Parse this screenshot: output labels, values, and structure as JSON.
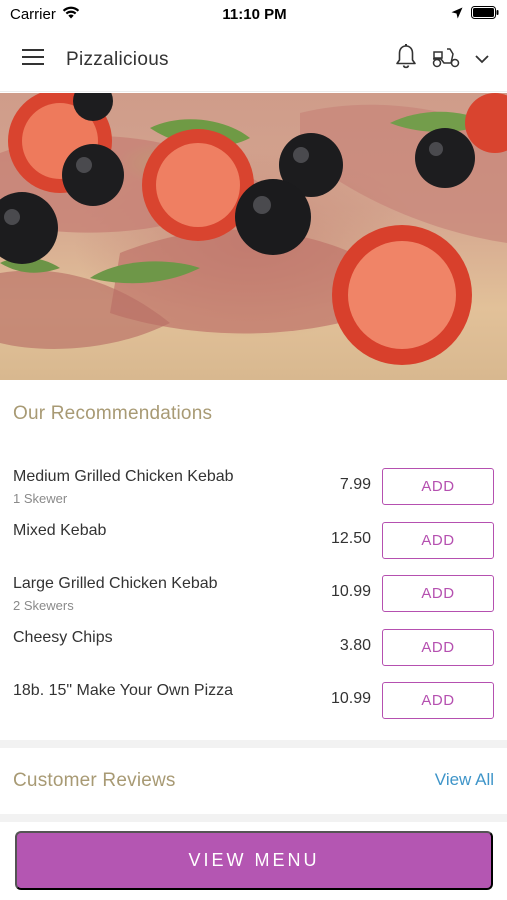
{
  "status_bar": {
    "carrier": "Carrier",
    "time": "11:10 PM"
  },
  "header": {
    "title": "Pizzalicious"
  },
  "icons": {
    "menu": "hamburger-menu-icon",
    "notifications": "bell-icon",
    "delivery": "scooter-icon",
    "dropdown": "chevron-down-icon"
  },
  "recommendations": {
    "title": "Our Recommendations",
    "add_label": "ADD",
    "items": [
      {
        "name": "Medium Grilled Chicken Kebab",
        "sub": "1 Skewer",
        "price": "7.99"
      },
      {
        "name": "Mixed Kebab",
        "sub": "",
        "price": "12.50"
      },
      {
        "name": "Large Grilled Chicken Kebab",
        "sub": "2 Skewers",
        "price": "10.99"
      },
      {
        "name": "Cheesy Chips",
        "sub": "",
        "price": "3.80"
      },
      {
        "name": "18b. 15\" Make Your Own Pizza",
        "sub": "",
        "price": "10.99"
      }
    ]
  },
  "reviews": {
    "title": "Customer Reviews",
    "view_all": "View All"
  },
  "footer": {
    "view_menu": "VIEW MENU"
  },
  "colors": {
    "accent": "#b456b2",
    "link": "#3f95c9",
    "section_title": "#a89a74"
  }
}
